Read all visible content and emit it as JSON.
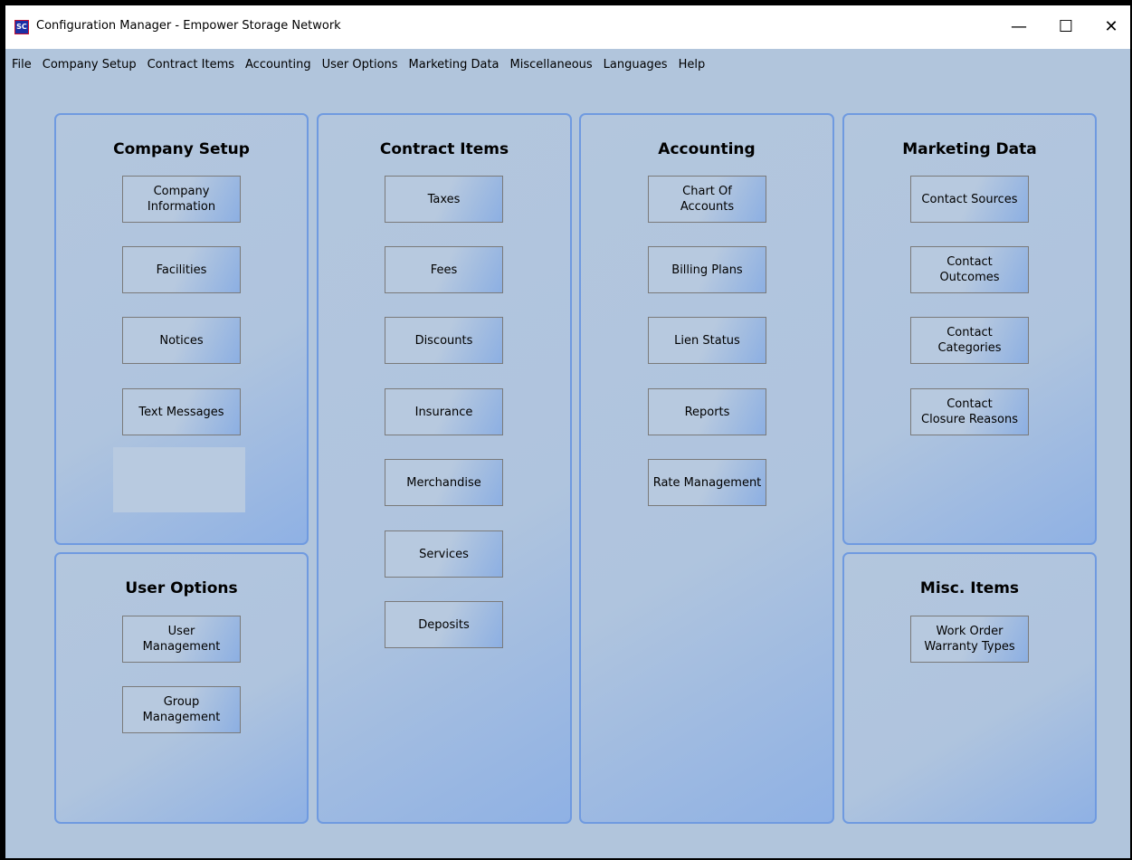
{
  "window": {
    "title": "Configuration Manager - Empower Storage Network",
    "controls": {
      "minimize": "—",
      "maximize": "☐",
      "close": "✕"
    }
  },
  "menu": [
    "File",
    "Company Setup",
    "Contract Items",
    "Accounting",
    "User Options",
    "Marketing Data",
    "Miscellaneous",
    "Languages",
    "Help"
  ],
  "panels": {
    "company_setup": {
      "title": "Company Setup",
      "buttons": [
        "Company\nInformation",
        "Facilities",
        "Notices",
        "Text Messages"
      ]
    },
    "user_options": {
      "title": "User Options",
      "buttons": [
        "User\nManagement",
        "Group\nManagement"
      ]
    },
    "contract_items": {
      "title": "Contract Items",
      "buttons": [
        "Taxes",
        "Fees",
        "Discounts",
        "Insurance",
        "Merchandise",
        "Services",
        "Deposits"
      ]
    },
    "accounting": {
      "title": "Accounting",
      "buttons": [
        "Chart Of\nAccounts",
        "Billing Plans",
        "Lien Status",
        "Reports",
        "Rate Management"
      ]
    },
    "marketing_data": {
      "title": "Marketing Data",
      "buttons": [
        "Contact Sources",
        "Contact\nOutcomes",
        "Contact\nCategories",
        "Contact\nClosure Reasons"
      ]
    },
    "misc_items": {
      "title": "Misc. Items",
      "buttons": [
        "Work Order\nWarranty Types"
      ]
    }
  },
  "colors": {
    "background": "#b1c5dc",
    "panel_border": "#6f9ae0",
    "button_border": "#7a7a7a"
  }
}
